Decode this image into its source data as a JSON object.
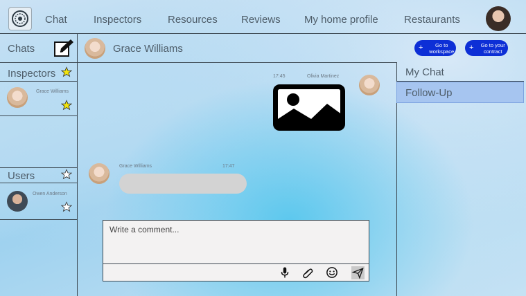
{
  "nav": {
    "items": [
      "Chat",
      "Inspectors",
      "Resources",
      "Reviews",
      "My home profile",
      "Restaurants"
    ]
  },
  "chats": {
    "header": "Chats",
    "active_contact": "Grace Williams"
  },
  "actions": {
    "workspace": "Go to workspace",
    "contract": "Go to your contract"
  },
  "inspectors": {
    "label": "Inspectors",
    "items": [
      {
        "name": "Grace Williams"
      }
    ]
  },
  "users": {
    "label": "Users",
    "items": [
      {
        "name": "Owen Anderson"
      }
    ]
  },
  "messages": [
    {
      "sender": "Olivia Martinez",
      "time": "17:45",
      "content": "image-icon"
    },
    {
      "sender": "Grace Williams",
      "time": "17:47",
      "content": ""
    }
  ],
  "right_panel": {
    "items": [
      "My Chat",
      "Follow-Up"
    ],
    "selected": "Follow-Up"
  },
  "composer": {
    "placeholder": "Write a comment..."
  },
  "colors": {
    "accent": "#0d2fd6",
    "selected": "#a6c5f0",
    "star": "#f2e40d",
    "bubble": "#d3d3d3"
  }
}
